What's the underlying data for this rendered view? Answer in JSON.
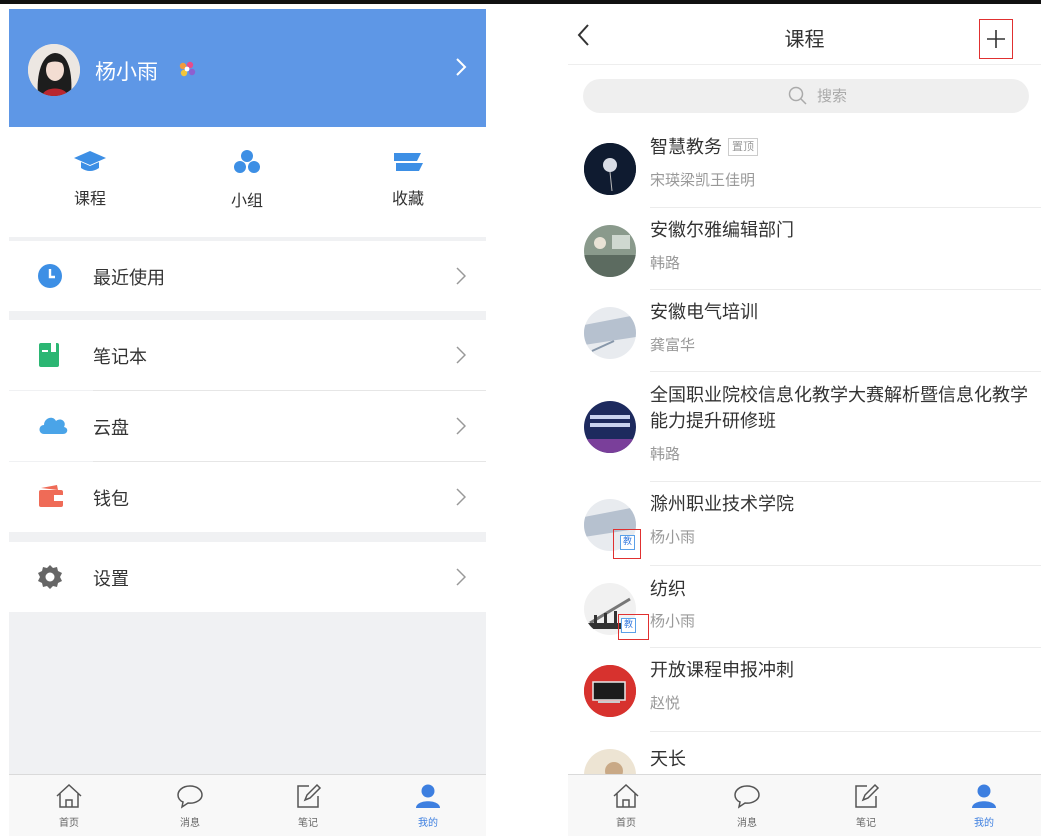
{
  "left": {
    "profile": {
      "name": "杨小雨"
    },
    "tiles": [
      {
        "label": "课程",
        "icon": "graduation-cap-icon"
      },
      {
        "label": "小组",
        "icon": "group-icon"
      },
      {
        "label": "收藏",
        "icon": "folder-icon"
      }
    ],
    "menu": [
      {
        "label": "最近使用",
        "icon": "clock-icon",
        "color": "#3d8fe5"
      },
      {
        "label": "笔记本",
        "icon": "notebook-icon",
        "color": "#2bb673"
      },
      {
        "label": "云盘",
        "icon": "cloud-icon",
        "color": "#4aa4e8"
      },
      {
        "label": "钱包",
        "icon": "wallet-icon",
        "color": "#ef6b57"
      },
      {
        "label": "设置",
        "icon": "gear-icon",
        "color": "#666666"
      }
    ]
  },
  "tabbar": [
    {
      "label": "首页",
      "icon": "home-icon"
    },
    {
      "label": "消息",
      "icon": "message-icon"
    },
    {
      "label": "笔记",
      "icon": "note-edit-icon"
    },
    {
      "label": "我的",
      "icon": "user-icon",
      "active": true
    }
  ],
  "right": {
    "title": "课程",
    "search_placeholder": "搜索",
    "pin_badge": "置顶",
    "teacher_badge": "教",
    "courses": [
      {
        "name": "智慧教务",
        "teacher": "宋瑛梁凯王佳明",
        "pinned": true
      },
      {
        "name": "安徽尔雅编辑部门",
        "teacher": "韩路"
      },
      {
        "name": "安徽电气培训",
        "teacher": "龚富华"
      },
      {
        "name": "全国职业院校信息化教学大赛解析暨信息化教学能力提升研修班",
        "teacher": "韩路"
      },
      {
        "name": "滁州职业技术学院",
        "teacher": "杨小雨",
        "teacher_badge": true
      },
      {
        "name": "纺织",
        "teacher": "杨小雨",
        "teacher_badge": true
      },
      {
        "name": "开放课程申报冲刺",
        "teacher": "赵悦"
      },
      {
        "name": "天长",
        "teacher": ""
      }
    ]
  },
  "colors": {
    "accent": "#5e97e6",
    "active_tab": "#3d7fe0",
    "highlight_box": "#e03030"
  }
}
